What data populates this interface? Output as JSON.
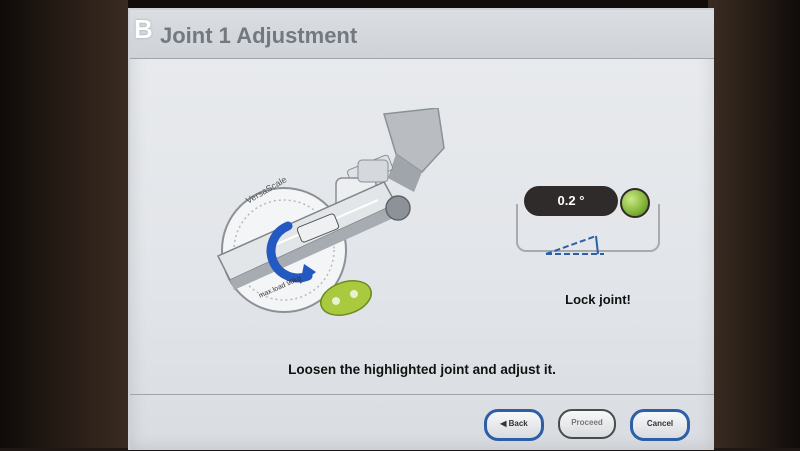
{
  "header": {
    "badge": "B",
    "title": "Joint 1 Adjustment"
  },
  "illustration": {
    "ring_label": "VersaScale",
    "tag_label": "max.load 90kg"
  },
  "reading": {
    "value": "0.2 °",
    "status_color": "#87b83a",
    "icon": "angle-icon",
    "status_text": "Lock joint!"
  },
  "instruction": "Loosen the highlighted joint and adjust it.",
  "buttons": {
    "back": "◀ Back",
    "proceed": "Proceed",
    "cancel": "Cancel"
  },
  "colors": {
    "accent": "#2c5fa8",
    "highlight_joint": "#2559c2",
    "lock_green": "#a9c93e"
  }
}
